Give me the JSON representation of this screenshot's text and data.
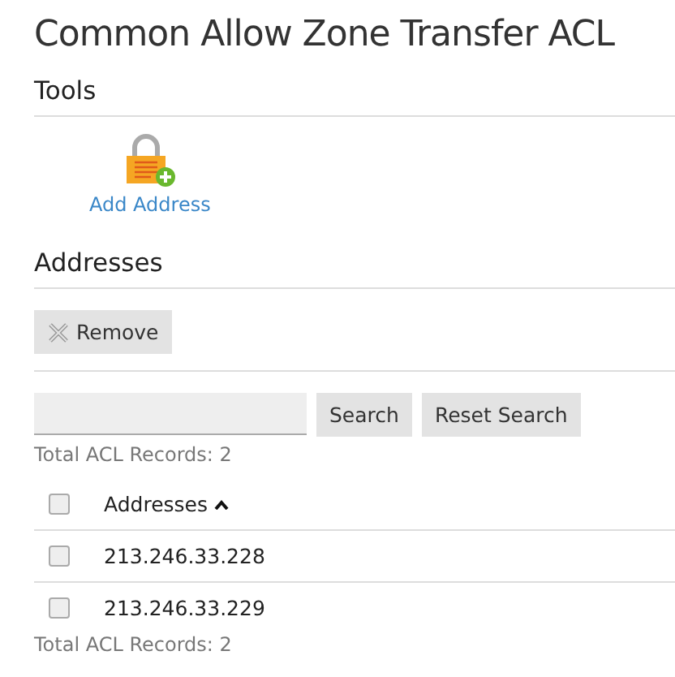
{
  "title": "Common Allow Zone Transfer ACL",
  "tools": {
    "heading": "Tools",
    "items": [
      {
        "label": "Add Address"
      }
    ]
  },
  "addresses": {
    "heading": "Addresses",
    "actions": [
      {
        "label": "Remove"
      }
    ],
    "search": {
      "button": "Search",
      "reset": "Reset Search"
    },
    "total_top": "Total ACL Records: 2",
    "table": {
      "header_checked": false,
      "columns": [
        {
          "label": "Addresses",
          "sorted_ascending": true
        }
      ],
      "rows": [
        {
          "checked": false,
          "address": "213.246.33.228"
        },
        {
          "checked": false,
          "address": "213.246.33.229"
        }
      ]
    },
    "total_bottom": "Total ACL Records: 2"
  }
}
